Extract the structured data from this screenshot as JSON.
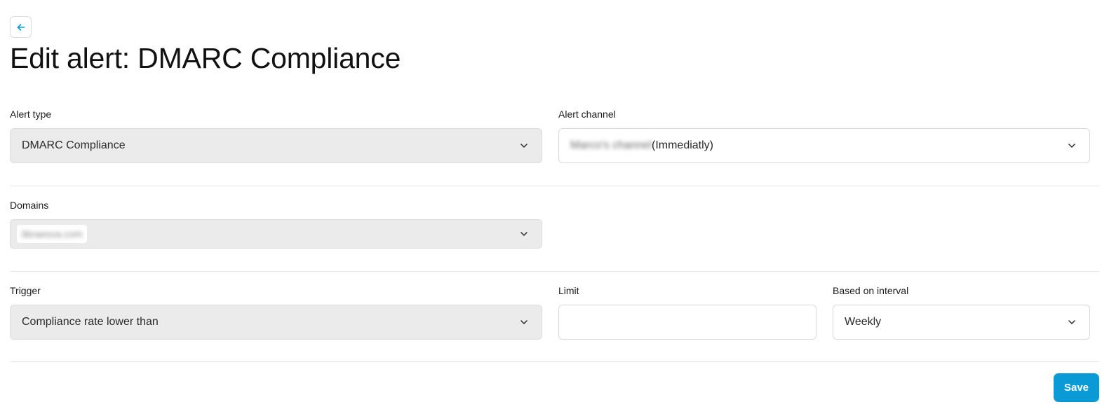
{
  "header": {
    "back_icon": "arrow-left-icon",
    "title": "Edit alert: DMARC Compliance"
  },
  "form": {
    "alert_type": {
      "label": "Alert type",
      "value": "DMARC Compliance"
    },
    "alert_channel": {
      "label": "Alert channel",
      "value_redacted": "Marco's channel",
      "value_suffix": "(Immediatly)"
    },
    "domains": {
      "label": "Domains",
      "chip_redacted": "libraesva.com"
    },
    "trigger": {
      "label": "Trigger",
      "value": "Compliance rate lower than"
    },
    "limit": {
      "label": "Limit",
      "value": ""
    },
    "interval": {
      "label": "Based on interval",
      "value": "Weekly"
    }
  },
  "actions": {
    "save_label": "Save"
  },
  "colors": {
    "accent": "#0a9bd6",
    "disabled_bg": "#ebebeb",
    "border": "#d6d9dc"
  }
}
